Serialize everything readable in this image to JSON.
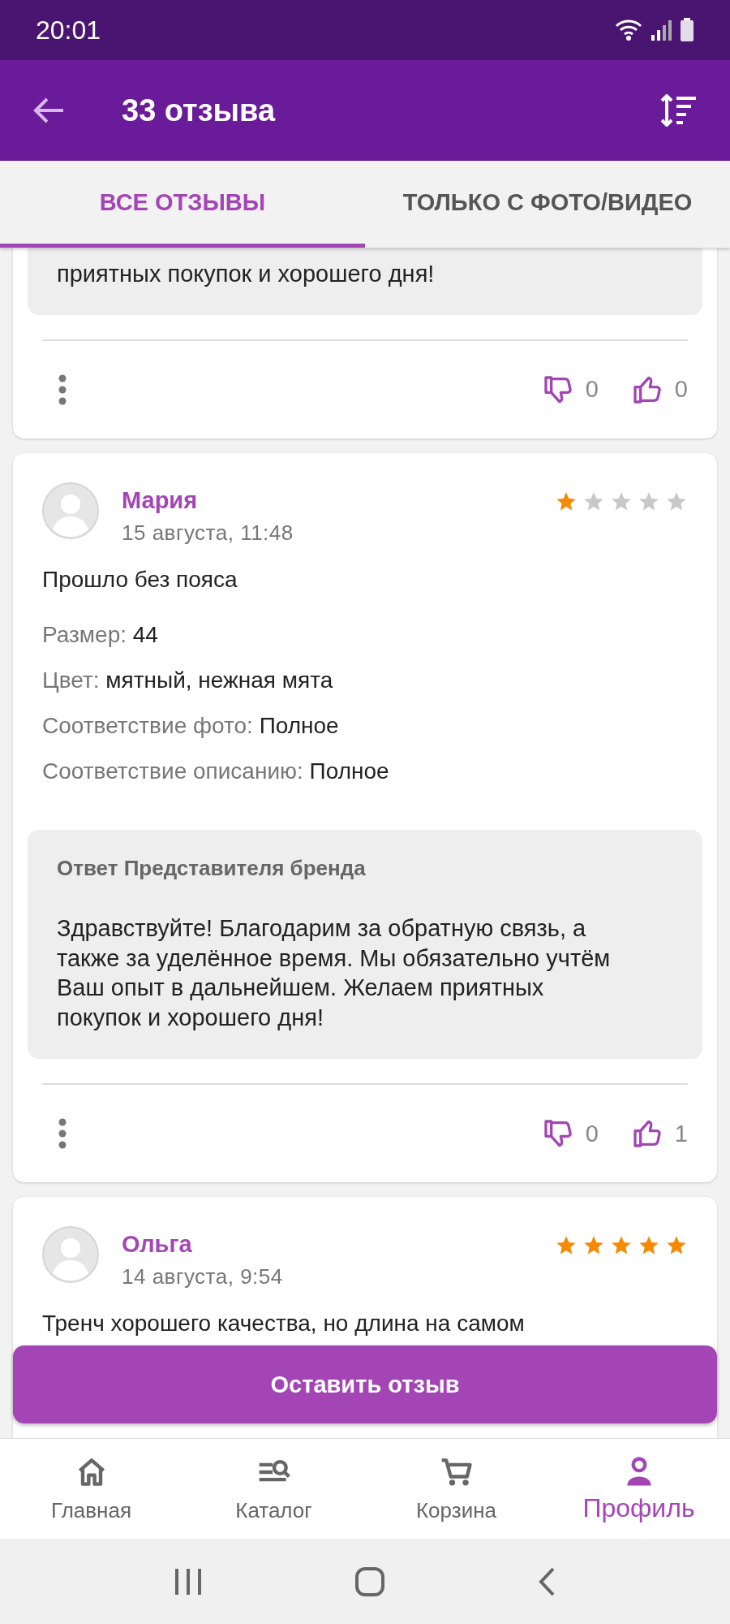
{
  "status_bar": {
    "time": "20:01"
  },
  "app_bar": {
    "title": "33 отзыва"
  },
  "tabs": [
    {
      "label": "ВСЕ ОТЗЫВЫ",
      "selected": true
    },
    {
      "label": "ТОЛЬКО С ФОТО/ВИДЕО",
      "selected": false
    }
  ],
  "reviews": [
    {
      "reply": {
        "text": "приятных покупок и хорошего дня!"
      },
      "dislikes": "0",
      "likes": "0"
    },
    {
      "author": "Мария",
      "date": "15 августа, 11:48",
      "stars": 1,
      "text": "Прошло без пояса",
      "details": [
        {
          "label": "Размер:",
          "value": "44"
        },
        {
          "label": "Цвет:",
          "value": "мятный, нежная мята"
        },
        {
          "label": "Соответствие фото:",
          "value": "Полное"
        },
        {
          "label": "Соответствие описанию:",
          "value": "Полное"
        }
      ],
      "reply": {
        "title": "Ответ Представителя бренда",
        "text": "Здравствуйте! Благодарим за обратную связь, а также за уделённое время. Мы обязательно учтём Ваш опыт в дальнейшем. Желаем приятных покупок и хорошего дня!"
      },
      "dislikes": "0",
      "likes": "1"
    },
    {
      "author": "Ольга",
      "date": "14 августа, 9:54",
      "stars": 5,
      "text": "Тренч хорошего качества, но длина на самом"
    }
  ],
  "action_button": {
    "label": "Оставить отзыв"
  },
  "bottom_nav": [
    {
      "label": "Главная",
      "selected": false
    },
    {
      "label": "Каталог",
      "selected": false
    },
    {
      "label": "Корзина",
      "selected": false
    },
    {
      "label": "Профиль",
      "selected": true
    }
  ]
}
